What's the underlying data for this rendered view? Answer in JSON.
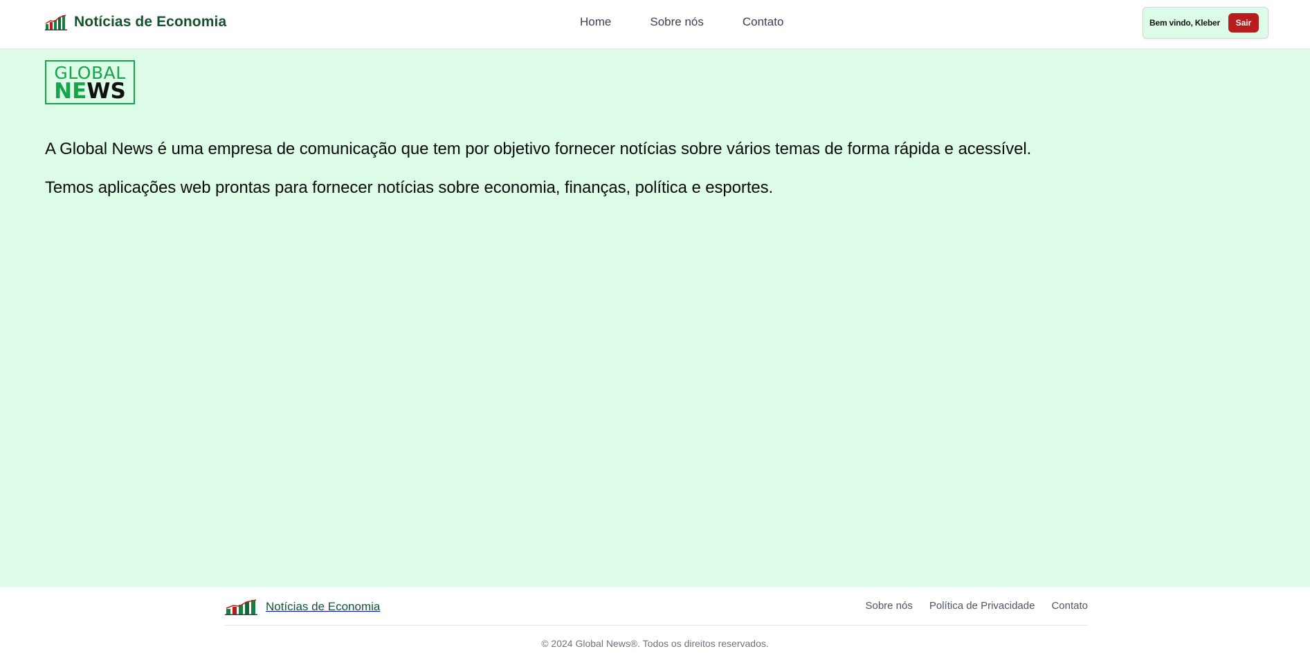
{
  "header": {
    "brand_icon": "growth-chart-icon",
    "brand_title": "Notícias de Economia",
    "nav": [
      {
        "label": "Home"
      },
      {
        "label": "Sobre nós"
      },
      {
        "label": "Contato"
      }
    ],
    "welcome": "Bem vindo, Kleber",
    "logout_label": "Sair"
  },
  "main": {
    "logo": {
      "line1": "GLOBAL",
      "line2_green": "NE",
      "line2_black": "WS"
    },
    "paragraphs": [
      "A Global News é uma empresa de comunicação que tem por objetivo fornecer notícias sobre vários temas de forma rápida e acessível.",
      "Temos aplicações web prontas para fornecer notícias sobre economia, finanças, política e esportes."
    ]
  },
  "footer": {
    "brand_icon": "growth-chart-icon",
    "brand_title": "Notícias de Economia",
    "links": [
      {
        "label": "Sobre nós"
      },
      {
        "label": "Política de Privacidade"
      },
      {
        "label": "Contato"
      }
    ],
    "copyright": "© 2024 Global News®. Todos os direitos reservados."
  },
  "colors": {
    "brand_green": "#14532d",
    "accent_green": "#16a34a",
    "page_background": "#dcfce7",
    "logout_red": "#b91c1c"
  }
}
